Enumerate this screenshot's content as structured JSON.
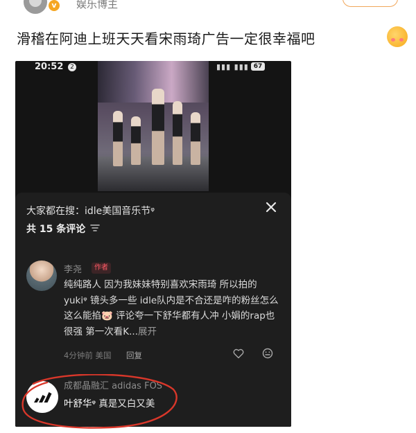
{
  "header": {
    "username": "娱乐博主",
    "verified_badge": "v",
    "follow_button": ""
  },
  "post": {
    "text": "滑稽在阿迪上班天天看宋雨琦广告一定很幸福吧",
    "emoji": "smiling-face-with-hearts"
  },
  "phone": {
    "status": {
      "time": "20:52",
      "notification_count": "2",
      "signal": "▮▮▮ ▮▮▮",
      "battery": "67"
    },
    "panel": {
      "search_line": "大家都在搜：idle美国音乐节ᵠ",
      "comment_count": "共 15 条评论",
      "comment": {
        "author": "李尧",
        "author_tag": "作者",
        "body": "纯纯路人 因为我妹妹特别喜欢宋雨琦 所以拍的 yukiᵠ 镜头多一些 idle队内是不合还是咋的粉丝怎么这么能掐🐷 评论夸一下舒华都有人冲 小娟的rap也很强  第一次看K...",
        "expand": "展开",
        "meta": "4分钟前 美国",
        "reply": "回复"
      },
      "adidas_comment": {
        "author": "成都晶融汇 adidas FOS",
        "body_name": "叶舒华ᵠ",
        "body_text": " 真是又白又美"
      }
    }
  },
  "colors": {
    "accent_red": "#d9372a",
    "panel_bg": "#1e1e1e",
    "tag_red": "#ff5a66"
  }
}
